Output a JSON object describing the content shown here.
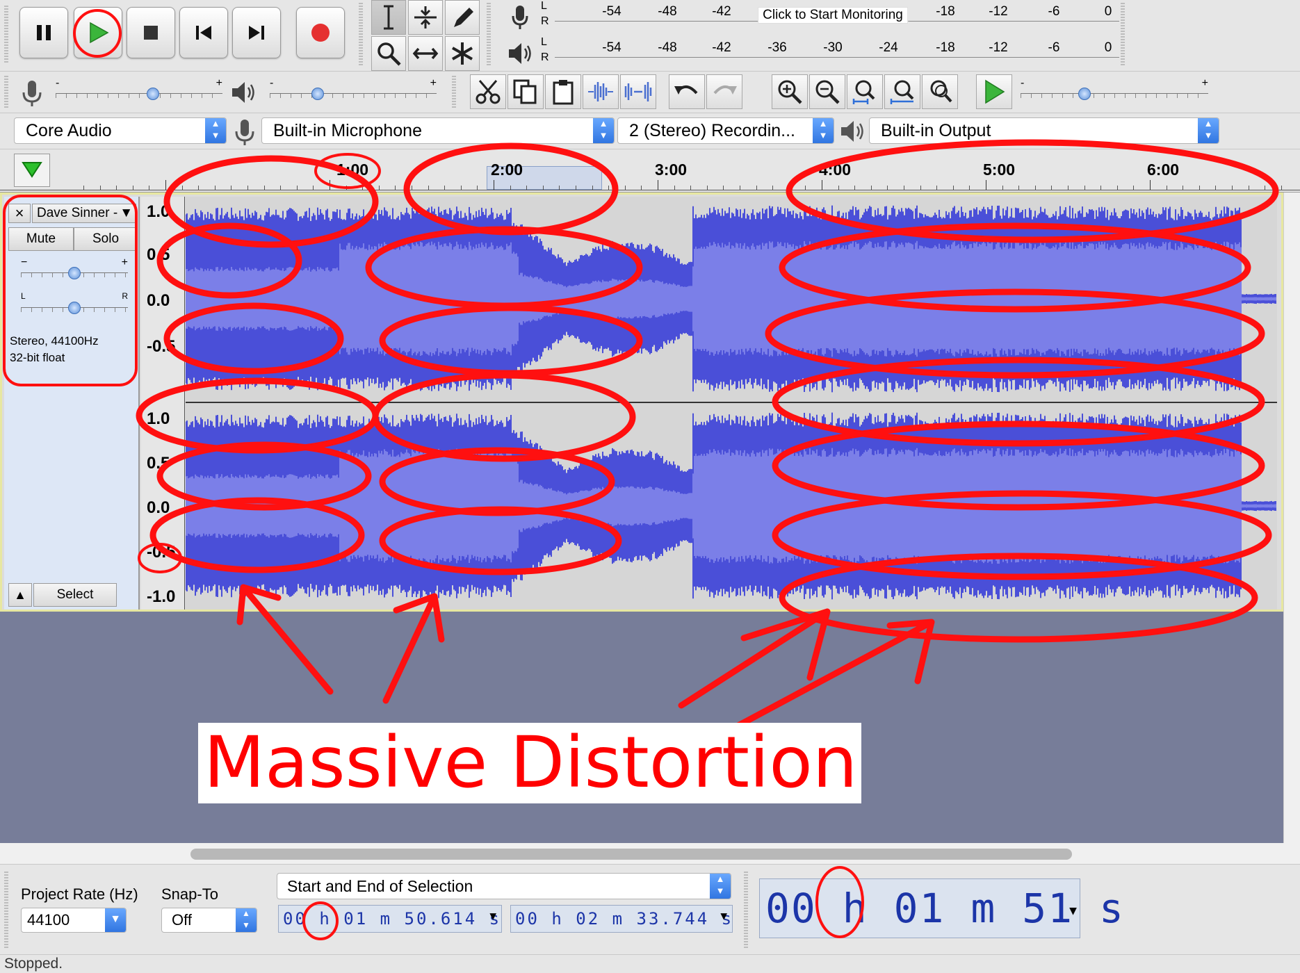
{
  "transport": {
    "buttons": [
      {
        "name": "pause-button",
        "icon": "pause-icon"
      },
      {
        "name": "play-button",
        "icon": "play-icon"
      },
      {
        "name": "stop-button",
        "icon": "stop-icon"
      },
      {
        "name": "skip-start-button",
        "icon": "skip-start-icon"
      },
      {
        "name": "skip-end-button",
        "icon": "skip-end-icon"
      },
      {
        "name": "record-button",
        "icon": "record-icon"
      }
    ]
  },
  "tools": [
    "selection-tool",
    "envelope-tool",
    "draw-tool",
    "zoom-tool",
    "time-shift-tool",
    "multi-tool"
  ],
  "meters": {
    "record": {
      "l": "L",
      "r": "R",
      "ticks": [
        "-54",
        "-48",
        "-42",
        "-18",
        "-12",
        "-6",
        "0"
      ],
      "prompt": "Click to Start Monitoring"
    },
    "playback": {
      "l": "L",
      "r": "R",
      "ticks": [
        "-54",
        "-48",
        "-42",
        "-36",
        "-30",
        "-24",
        "-18",
        "-12",
        "-6",
        "0"
      ]
    }
  },
  "mixer": {
    "min": "-",
    "max": "+",
    "record_level": 0.59,
    "playback_level": 0.27
  },
  "play_at_speed": {
    "min": "-",
    "max": "+",
    "level": 0.33
  },
  "devices": {
    "host": "Core Audio",
    "input": "Built-in Microphone",
    "channels": "2 (Stereo) Recordin...",
    "output": "Built-in Output"
  },
  "timeline": {
    "labels": [
      "1:00",
      "2:00",
      "3:00",
      "4:00",
      "5:00",
      "6:00"
    ]
  },
  "track": {
    "name": "Dave Sinner -",
    "close": "×",
    "mute": "Mute",
    "solo": "Solo",
    "gain_min": "−",
    "gain_max": "+",
    "pan_left": "L",
    "pan_right": "R",
    "gain_level": 0.5,
    "pan_level": 0.5,
    "info_line1": "Stereo, 44100Hz",
    "info_line2": "32-bit float",
    "collapse": "▲",
    "select": "Select",
    "scale_top": [
      "1.0",
      "0.5",
      "0.0",
      "-0.5"
    ],
    "scale_bottom": [
      "1.0",
      "0.5",
      "0.0",
      "-0.5",
      "-1.0"
    ],
    "wave_color": "#4a4fd8",
    "wave_rms_color": "#7b7fe8"
  },
  "selection_toolbar": {
    "project_rate_label": "Project Rate (Hz)",
    "project_rate": "44100",
    "snap_label": "Snap-To",
    "snap_value": "Off",
    "mode": "Start and End of Selection",
    "start_time": "00 h 01 m 50.614 s",
    "end_time": "00 h 02 m 33.744 s",
    "audio_position": "00 h 01 m 51 s"
  },
  "status": "Stopped.",
  "annotation": {
    "text": "Massive Distortion",
    "color": "#ff0000"
  }
}
